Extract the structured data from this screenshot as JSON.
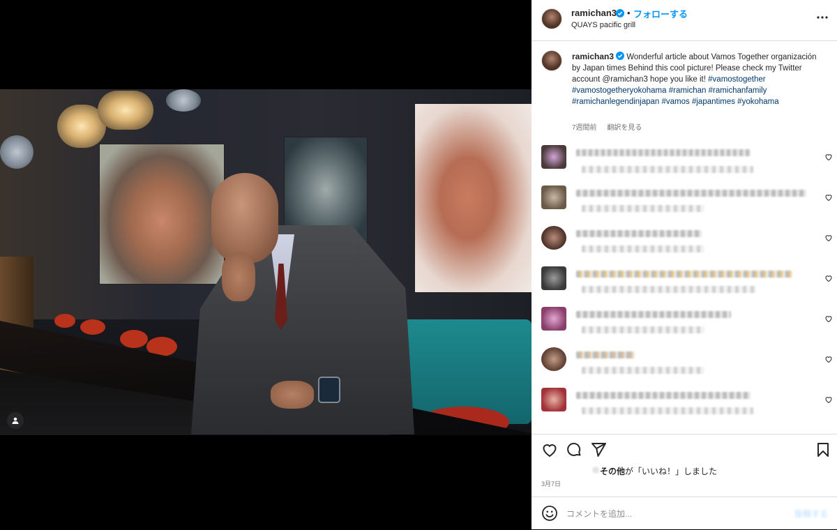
{
  "post": {
    "username": "ramichan3",
    "follow_label": "フォローする",
    "location": "QUAYS pacific grill",
    "caption_text": "Wonderful article about Vamos Together organización by Japan times Behind this cool picture! Please check my Twitter account @ramichan3 hope you like it!",
    "caption_tags": "#vamostogether #vamostogetheryokohama #ramichan #ramichanfamily #ramichanlegendinjapan #vamos #japantimes #yokohama",
    "caption_time": "7週間前",
    "translate_label": "翻訳を見る",
    "likes_text": "その他",
    "likes_suffix": "が「いいね！」しました",
    "date": "3月7日",
    "comment_placeholder": "コメントを追加...",
    "post_button": "投稿する"
  },
  "icons": {
    "verified": "verified-badge-icon",
    "more": "more-options-icon",
    "like": "heart-icon",
    "comment": "comment-icon",
    "share": "share-icon",
    "save": "bookmark-icon",
    "emoji": "emoji-icon",
    "tagged": "user-tag-icon"
  },
  "colors": {
    "accent": "#0095f6",
    "text": "#262626",
    "secondary": "#737373",
    "hashtag": "#00376b",
    "border": "#dbdbdb"
  }
}
